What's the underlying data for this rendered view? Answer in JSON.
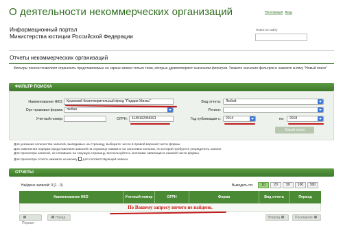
{
  "header": {
    "site_title": "О деятельности некоммерческих организаций",
    "login_link": "Регистрация",
    "login_link2": "Вход",
    "portal_line1": "Информационный портал",
    "portal_line2": "Министерства юстиции Российской Федерации",
    "search_label": "Поиск по сайту"
  },
  "section": {
    "title": "Отчеты некоммерческих организаций",
    "intro": "Фильтры поиска позволяют ограничить представляемые на экране записи только теми, которые удовлетворяют значениям фильтров. Укажите значения фильтров и нажмите кнопку \"Новый поиск\""
  },
  "filter": {
    "bar_title": "ФИЛЬТР ПОИСКА",
    "nko_name_label": "Наименование НКО:",
    "nko_name_value": "Крымский благотворительный фонд \"Подари Жизнь\"",
    "legal_form_label": "Орг.-правовая форма:",
    "legal_form_value": "любая",
    "account_label": "Учетный номер:",
    "account_value": "",
    "ogrn_label": "ОГРН:",
    "ogrn_value": "1149102059391",
    "report_type_label": "Вид отчета:",
    "report_type_value": "Любой",
    "region_label": "Регион:",
    "region_value": "",
    "year_from_label": "Год публикации с:",
    "year_from_value": "2014",
    "year_to_label": "по:",
    "year_to_value": "2018",
    "new_search_button": "Новый поиск"
  },
  "notes": {
    "line1": "Для указания количества записей, выводимых на страницу, выберите число в правой верхней части формы.",
    "line2": "Для изменения порядка представления записей на странице нажмите на заголовок колонки, по которой требуется упорядочить записи.",
    "line3": "Для просмотра записей, не попавших на текущую страницу, воспользуйтесь кнопками навигации в нижней части формы.",
    "line4_a": "Для просмотра отчета нажмите на иконку",
    "line4_b": "для соответствующей записи."
  },
  "reports": {
    "bar_title": "ОТЧЕТЫ",
    "found_text": "Найдено записей: 0   [1 - 0]",
    "per_page_label": "Выводить по:",
    "per_page_options": [
      "10",
      "20",
      "50",
      "100",
      "500"
    ],
    "columns": [
      "Наименование НКО",
      "Учетный номер",
      "ОГРН",
      "Форма",
      "Вид отчета",
      "Период"
    ],
    "no_results": "По Вашему запросу ничего не найдено."
  },
  "pager": {
    "first": "Первая",
    "prev": "Назад",
    "next": "Вперед",
    "last": "Последняя"
  },
  "colors": {
    "brand_green": "#2f6e1f",
    "bar_green": "#4a8a34",
    "annotation_red": "#c0191b",
    "select_blue": "#3b78d8"
  }
}
